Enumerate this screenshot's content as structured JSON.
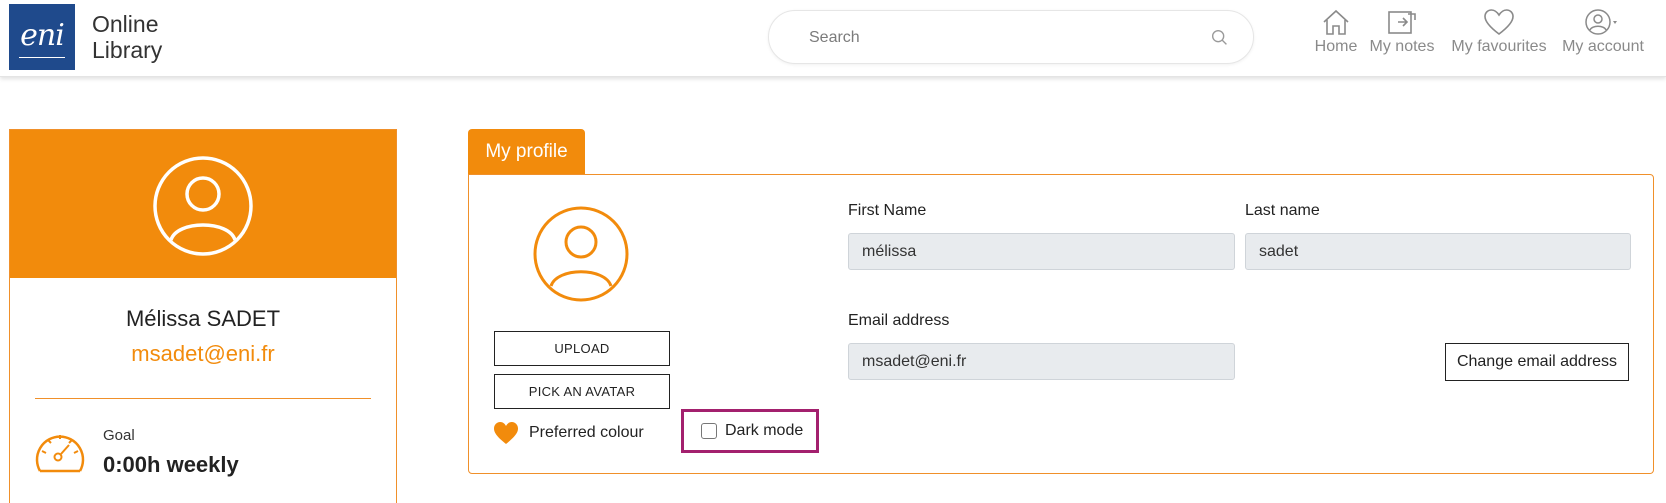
{
  "header": {
    "logo_text": "eni",
    "app_title_line1": "Online",
    "app_title_line2": "Library",
    "search_placeholder": "Search",
    "nav": {
      "home": "Home",
      "notes": "My notes",
      "favourites": "My favourites",
      "account": "My account"
    }
  },
  "user_card": {
    "name": "Mélissa SADET",
    "email": "msadet@eni.fr",
    "goal_label": "Goal",
    "goal_value": "0:00h weekly"
  },
  "profile": {
    "tab_label": "My profile",
    "upload_label": "UPLOAD",
    "pick_avatar_label": "PICK AN AVATAR",
    "preferred_colour_label": "Preferred colour",
    "dark_mode_label": "Dark mode",
    "dark_mode_checked": false,
    "first_name_label": "First Name",
    "first_name_value": "mélissa",
    "last_name_label": "Last name",
    "last_name_value": "sadet",
    "email_label": "Email address",
    "email_value": "msadet@eni.fr",
    "change_email_label": "Change email address"
  },
  "colors": {
    "accent": "#f28b0c",
    "brand": "#1f4a8c",
    "highlight_border": "#a3206e",
    "field_bg": "#e8ebee"
  },
  "icons": {
    "search": "search-icon",
    "home": "home-icon",
    "notes": "notes-icon",
    "favourites": "heart-icon",
    "account": "user-circle-icon",
    "goal": "speedometer-icon"
  }
}
